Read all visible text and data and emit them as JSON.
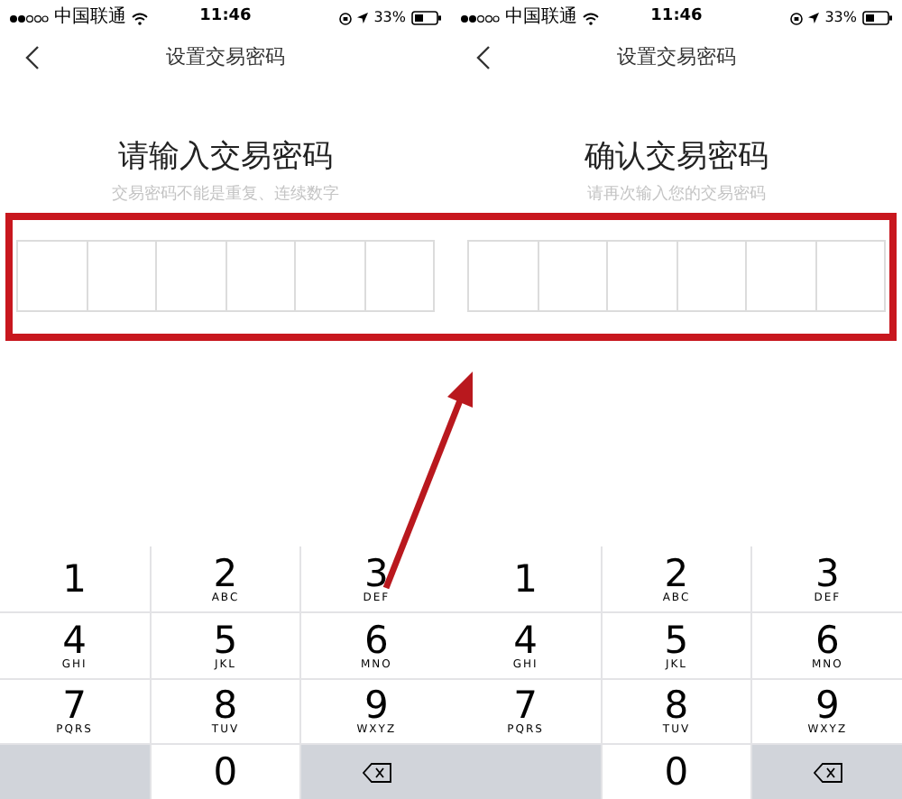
{
  "screens": [
    {
      "status_bar": {
        "carrier": "中国联通",
        "time": "11:46",
        "battery": "33%"
      },
      "nav": {
        "title": "设置交易密码"
      },
      "heading": "请输入交易密码",
      "hint": "交易密码不能是重复、连续数字",
      "keypad": [
        {
          "kind": "digit",
          "digit": "1"
        },
        {
          "kind": "digit",
          "digit": "2",
          "letters": "ABC"
        },
        {
          "kind": "digit",
          "digit": "3",
          "letters": "DEF"
        },
        {
          "kind": "digit",
          "digit": "4",
          "letters": "GHI"
        },
        {
          "kind": "digit",
          "digit": "5",
          "letters": "JKL"
        },
        {
          "kind": "digit",
          "digit": "6",
          "letters": "MNO"
        },
        {
          "kind": "digit",
          "digit": "7",
          "letters": "PQRS"
        },
        {
          "kind": "digit",
          "digit": "8",
          "letters": "TUV"
        },
        {
          "kind": "digit",
          "digit": "9",
          "letters": "WXYZ"
        },
        {
          "kind": "blank"
        },
        {
          "kind": "digit",
          "digit": "0"
        },
        {
          "kind": "delete"
        }
      ]
    },
    {
      "status_bar": {
        "carrier": "中国联通",
        "time": "11:46",
        "battery": "33%"
      },
      "nav": {
        "title": "设置交易密码"
      },
      "heading": "确认交易密码",
      "hint": "请再次输入您的交易密码",
      "keypad": [
        {
          "kind": "digit",
          "digit": "1"
        },
        {
          "kind": "digit",
          "digit": "2",
          "letters": "ABC"
        },
        {
          "kind": "digit",
          "digit": "3",
          "letters": "DEF"
        },
        {
          "kind": "digit",
          "digit": "4",
          "letters": "GHI"
        },
        {
          "kind": "digit",
          "digit": "5",
          "letters": "JKL"
        },
        {
          "kind": "digit",
          "digit": "6",
          "letters": "MNO"
        },
        {
          "kind": "digit",
          "digit": "7",
          "letters": "PQRS"
        },
        {
          "kind": "digit",
          "digit": "8",
          "letters": "TUV"
        },
        {
          "kind": "digit",
          "digit": "9",
          "letters": "WXYZ"
        },
        {
          "kind": "blank"
        },
        {
          "kind": "digit",
          "digit": "0"
        },
        {
          "kind": "delete"
        }
      ]
    }
  ]
}
